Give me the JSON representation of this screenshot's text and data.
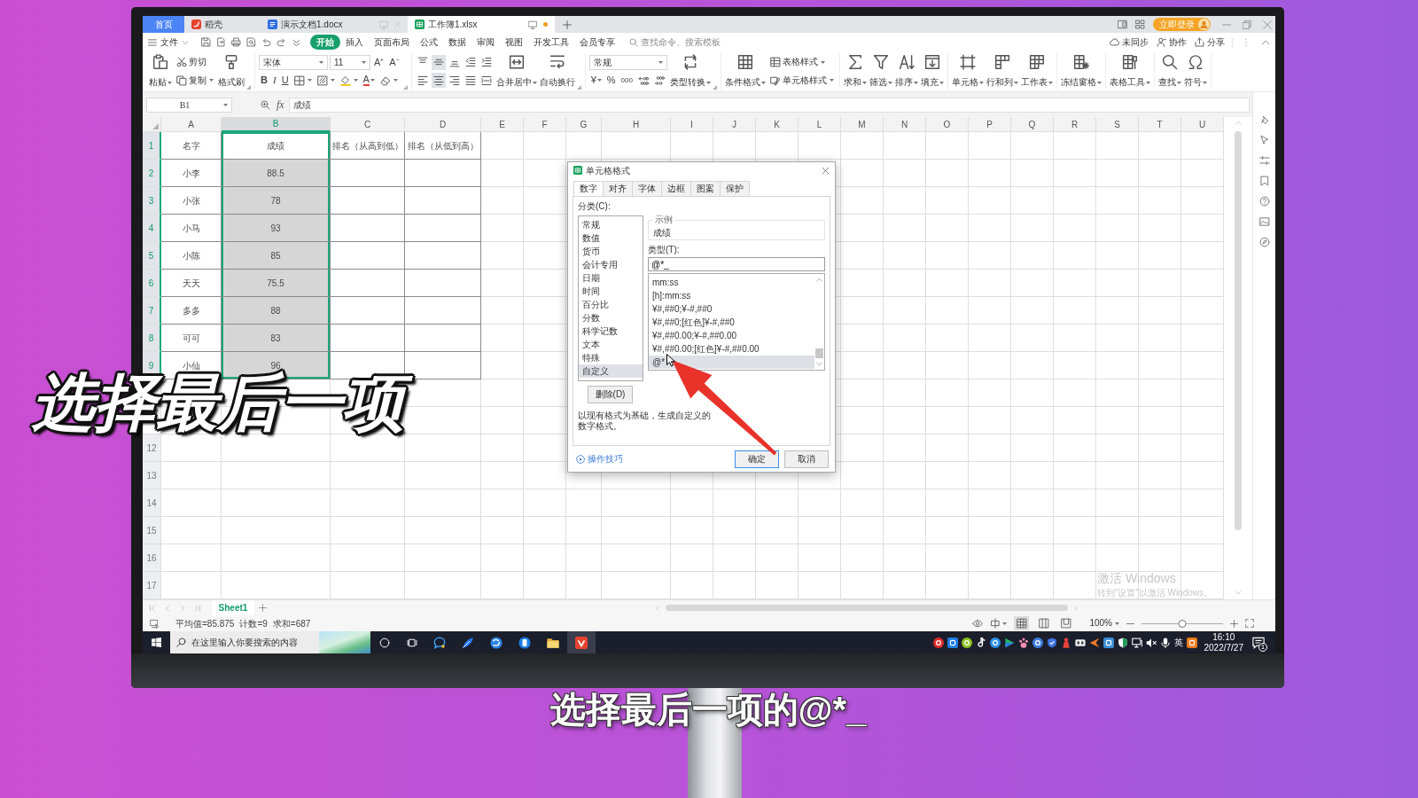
{
  "title_bar": {
    "tabs": [
      {
        "kind": "home",
        "label": "首页",
        "selected": false
      },
      {
        "kind": "docer",
        "label": "稻壳",
        "selected": false
      },
      {
        "kind": "writer",
        "label": "演示文档1.docx",
        "selected": false,
        "unsaved": false
      },
      {
        "kind": "sheet",
        "label": "工作簿1.xlsx",
        "selected": true,
        "unsaved": true
      }
    ],
    "login": "立即登录"
  },
  "menu": {
    "file": "文件",
    "tabs": [
      {
        "label": "开始",
        "selected": true
      },
      {
        "label": "插入",
        "selected": false
      },
      {
        "label": "页面布局",
        "selected": false
      },
      {
        "label": "公式",
        "selected": false
      },
      {
        "label": "数据",
        "selected": false
      },
      {
        "label": "审阅",
        "selected": false
      },
      {
        "label": "视图",
        "selected": false
      },
      {
        "label": "开发工具",
        "selected": false
      },
      {
        "label": "会员专享",
        "selected": false
      }
    ],
    "search": {
      "placeholder": "查找命令、搜索模板"
    },
    "actions": [
      {
        "kind": "sync",
        "label": "未同步"
      },
      {
        "kind": "collab",
        "label": "协作"
      },
      {
        "kind": "share",
        "label": "分享"
      }
    ]
  },
  "ribbon": [
    {
      "launcher": true,
      "items": [
        {
          "kind": "paste",
          "label": "粘贴",
          "dropdown": true
        },
        {
          "kind": "stack",
          "upper": [
            {
              "kind": "cut",
              "label": "剪切",
              "dropdown": false
            }
          ],
          "lower": [
            {
              "kind": "copy",
              "label": "复制",
              "dropdown": true
            }
          ]
        },
        {
          "kind": "brush",
          "label": "格式刷",
          "dropdown": false
        }
      ]
    },
    {
      "launcher": true,
      "items": [
        {
          "kind": "stack",
          "upper": [
            {
              "kind": "fontname",
              "value": "宋体"
            },
            {
              "kind": "fontsize",
              "value": "11"
            },
            {
              "kind": "grow",
              "label": "A⁺"
            },
            {
              "kind": "shrink",
              "label": "A⁻"
            }
          ],
          "lower": [
            {
              "kind": "bold",
              "label": "B"
            },
            {
              "kind": "italic",
              "label": "I"
            },
            {
              "kind": "underline",
              "label": "U"
            },
            {
              "kind": "border",
              "dropdown": true
            },
            {
              "kind": "shade",
              "dropdown": true
            },
            {
              "kind": "highlight",
              "dropdown": true
            },
            {
              "kind": "fontcolor",
              "label": "A",
              "dropdown": true
            },
            {
              "kind": "eraser",
              "dropdown": true
            }
          ]
        }
      ]
    },
    {
      "launcher": true,
      "items": [
        {
          "kind": "stack",
          "upper": [
            {
              "kind": "top",
              "selected": false
            },
            {
              "kind": "middle",
              "selected": true
            },
            {
              "kind": "bottom",
              "selected": false
            },
            {
              "kind": "outdent",
              "selected": false
            },
            {
              "kind": "indent",
              "selected": false
            }
          ],
          "lower": [
            {
              "kind": "left",
              "selected": false
            },
            {
              "kind": "center",
              "selected": true
            },
            {
              "kind": "right",
              "selected": false
            },
            {
              "kind": "justify",
              "selected": false
            },
            {
              "kind": "distribute",
              "selected": false
            }
          ]
        },
        {
          "kind": "merge",
          "label": "合并居中",
          "dropdown": true
        },
        {
          "kind": "wrap",
          "label": "自动换行",
          "dropdown": false
        }
      ]
    },
    {
      "launcher": true,
      "items": [
        {
          "kind": "stack",
          "upper": [
            {
              "kind": "numfmt",
              "value": "常规"
            }
          ],
          "lower": [
            {
              "kind": "currency",
              "label": "¥",
              "dropdown": true
            },
            {
              "kind": "percent",
              "label": "%"
            },
            {
              "kind": "thousands",
              "label": "000"
            },
            {
              "kind": "moredec"
            },
            {
              "kind": "lessdec"
            }
          ]
        },
        {
          "kind": "convert",
          "label": "类型转换",
          "dropdown": true
        }
      ]
    },
    {
      "launcher": false,
      "items": [
        {
          "kind": "condfmt",
          "label": "条件格式",
          "dropdown": true
        },
        {
          "kind": "stack",
          "upper": [
            {
              "kind": "tablestyle",
              "label": "表格样式",
              "dropdown": true
            }
          ],
          "lower": [
            {
              "kind": "cellstyle",
              "label": "单元格样式",
              "dropdown": true
            }
          ]
        }
      ]
    },
    {
      "launcher": false,
      "items": [
        {
          "kind": "sum",
          "label": "求和",
          "dropdown": true
        },
        {
          "kind": "filter",
          "label": "筛选",
          "dropdown": true
        },
        {
          "kind": "sort",
          "label": "排序",
          "dropdown": true
        },
        {
          "kind": "fill",
          "label": "填充",
          "dropdown": true
        }
      ]
    },
    {
      "launcher": false,
      "items": [
        {
          "kind": "cells",
          "label": "单元格",
          "dropdown": true
        },
        {
          "kind": "rowcol",
          "label": "行和列",
          "dropdown": true
        },
        {
          "kind": "worksheet",
          "label": "工作表",
          "dropdown": true
        }
      ]
    },
    {
      "launcher": false,
      "items": [
        {
          "kind": "freeze",
          "label": "冻结窗格",
          "dropdown": true
        }
      ]
    },
    {
      "launcher": false,
      "items": [
        {
          "kind": "tools",
          "label": "表格工具",
          "dropdown": true
        }
      ]
    },
    {
      "launcher": false,
      "items": [
        {
          "kind": "find",
          "label": "查找",
          "dropdown": true
        },
        {
          "kind": "symbol",
          "label": "符号",
          "dropdown": true
        }
      ]
    }
  ],
  "formula_bar": {
    "cell": "B1",
    "function_label": "fx",
    "formula": "成绩"
  },
  "sheet": {
    "columns": [
      {
        "label": "A",
        "selected": false
      },
      {
        "label": "B",
        "selected": true
      },
      {
        "label": "C",
        "selected": false
      },
      {
        "label": "D",
        "selected": false
      },
      {
        "label": "E",
        "selected": false
      },
      {
        "label": "F",
        "selected": false
      },
      {
        "label": "G",
        "selected": false
      },
      {
        "label": "H",
        "selected": false
      },
      {
        "label": "I",
        "selected": false
      },
      {
        "label": "J",
        "selected": false
      },
      {
        "label": "K",
        "selected": false
      },
      {
        "label": "L",
        "selected": false
      },
      {
        "label": "M",
        "selected": false
      },
      {
        "label": "N",
        "selected": false
      },
      {
        "label": "O",
        "selected": false
      },
      {
        "label": "P",
        "selected": false
      },
      {
        "label": "Q",
        "selected": false
      },
      {
        "label": "R",
        "selected": false
      },
      {
        "label": "S",
        "selected": false
      },
      {
        "label": "T",
        "selected": false
      },
      {
        "label": "U",
        "selected": false
      }
    ],
    "rows": [
      {
        "header": "1",
        "selected": true,
        "cells": [
          "名字",
          "成绩",
          "排名（从高到低）",
          "排名（从低到高）"
        ]
      },
      {
        "header": "2",
        "selected": true,
        "cells": [
          "小李",
          "88.5"
        ]
      },
      {
        "header": "3",
        "selected": true,
        "cells": [
          "小张",
          "78"
        ]
      },
      {
        "header": "4",
        "selected": true,
        "cells": [
          "小马",
          "93"
        ]
      },
      {
        "header": "5",
        "selected": true,
        "cells": [
          "小陈",
          "85"
        ]
      },
      {
        "header": "6",
        "selected": true,
        "cells": [
          "天天",
          "75.5"
        ]
      },
      {
        "header": "7",
        "selected": true,
        "cells": [
          "多多",
          "88"
        ]
      },
      {
        "header": "8",
        "selected": true,
        "cells": [
          "可可",
          "83"
        ]
      },
      {
        "header": "9",
        "selected": true,
        "cells": [
          "小仙",
          "96"
        ]
      },
      {
        "selected": false
      },
      {
        "selected": false
      },
      {
        "header": "12",
        "selected": false
      },
      {
        "header": "13",
        "selected": false
      },
      {
        "header": "14",
        "selected": false
      },
      {
        "header": "15",
        "selected": false
      },
      {
        "header": "16",
        "selected": false
      },
      {
        "header": "17",
        "selected": false
      }
    ],
    "activation": {
      "title": "激活 Windows",
      "hint": "转到“设置”以激活 Windows。"
    }
  },
  "dialog": {
    "title": "单元格格式",
    "tabs": [
      {
        "label": "数字",
        "selected": true
      },
      {
        "label": "对齐",
        "selected": false
      },
      {
        "label": "字体",
        "selected": false
      },
      {
        "label": "边框",
        "selected": false
      },
      {
        "label": "图案",
        "selected": false
      },
      {
        "label": "保护",
        "selected": false
      }
    ],
    "category_label": "分类(C):",
    "categories": [
      {
        "label": "常规",
        "selected": false
      },
      {
        "label": "数值",
        "selected": false
      },
      {
        "label": "货币",
        "selected": false
      },
      {
        "label": "会计专用",
        "selected": false
      },
      {
        "label": "日期",
        "selected": false
      },
      {
        "label": "时间",
        "selected": false
      },
      {
        "label": "百分比",
        "selected": false
      },
      {
        "label": "分数",
        "selected": false
      },
      {
        "label": "科学记数",
        "selected": false
      },
      {
        "label": "文本",
        "selected": false
      },
      {
        "label": "特殊",
        "selected": false
      },
      {
        "label": "自定义",
        "selected": true
      }
    ],
    "delete": "删除(D)",
    "sample": {
      "legend": "示例",
      "value": "成绩"
    },
    "type_label": "类型(T):",
    "type": {
      "value": "@*_"
    },
    "types": [
      {
        "label": "mm:ss",
        "selected": false
      },
      {
        "label": "[h]:mm:ss",
        "selected": false
      },
      {
        "label": "¥#,##0;¥-#,##0",
        "selected": false
      },
      {
        "label": "¥#,##0;[红色]¥-#,##0",
        "selected": false
      },
      {
        "label": "¥#,##0.00;¥-#,##0.00",
        "selected": false
      },
      {
        "label": "¥#,##0.00;[红色]¥-#,##0.00",
        "selected": false
      },
      {
        "label": "@*",
        "selected": true
      }
    ],
    "description": "以现有格式为基础，生成自定义的数字格式。",
    "tips": "操作技巧",
    "ok": "确定",
    "cancel": "取消"
  },
  "sheet_tabs": [
    {
      "label": "Sheet1",
      "selected": true
    }
  ],
  "status_bar": {
    "stats": [
      "平均值=85.875",
      "计数=9",
      "求和=687"
    ],
    "views": [
      {
        "kind": "normal",
        "selected": true
      },
      {
        "kind": "pagebreak",
        "selected": false
      },
      {
        "kind": "reading",
        "selected": false
      }
    ],
    "zoom": "100%",
    "zoom_slider": {
      "level": 0.5
    }
  },
  "taskbar": {
    "search": {
      "placeholder": "在这里输入你要搜索的内容"
    },
    "apps": [
      {
        "kind": "chat",
        "selected": false
      },
      {
        "kind": "feather",
        "selected": false
      },
      {
        "kind": "browser",
        "selected": false
      },
      {
        "kind": "phone",
        "selected": false
      },
      {
        "kind": "folder",
        "selected": false
      },
      {
        "kind": "office",
        "selected": true
      }
    ],
    "tray": [
      {
        "kind": "disc",
        "color": "#e02b2b"
      },
      {
        "kind": "tile",
        "color": "#1f7fe8"
      },
      {
        "kind": "disc",
        "color": "#8cc21f"
      },
      {
        "kind": "note"
      },
      {
        "kind": "disc",
        "color": "#2b90ea"
      },
      {
        "kind": "play"
      },
      {
        "kind": "paw"
      },
      {
        "kind": "disc",
        "color": "#3f7fe0"
      },
      {
        "kind": "shield"
      },
      {
        "kind": "figure"
      },
      {
        "kind": "box"
      },
      {
        "kind": "flag"
      },
      {
        "kind": "tile",
        "color": "#3a8fd6"
      },
      {
        "kind": "guard"
      },
      {
        "kind": "monitor"
      },
      {
        "kind": "mute"
      },
      {
        "kind": "mic"
      },
      {
        "kind": "ime",
        "label": "英"
      },
      {
        "kind": "tile",
        "color": "#f07a1a"
      }
    ],
    "time": "16:10",
    "date": "2022/7/27",
    "notifications": "1"
  },
  "captions": {
    "title": "选择最后一项",
    "subtitle": "选择最后一项的@*_"
  }
}
